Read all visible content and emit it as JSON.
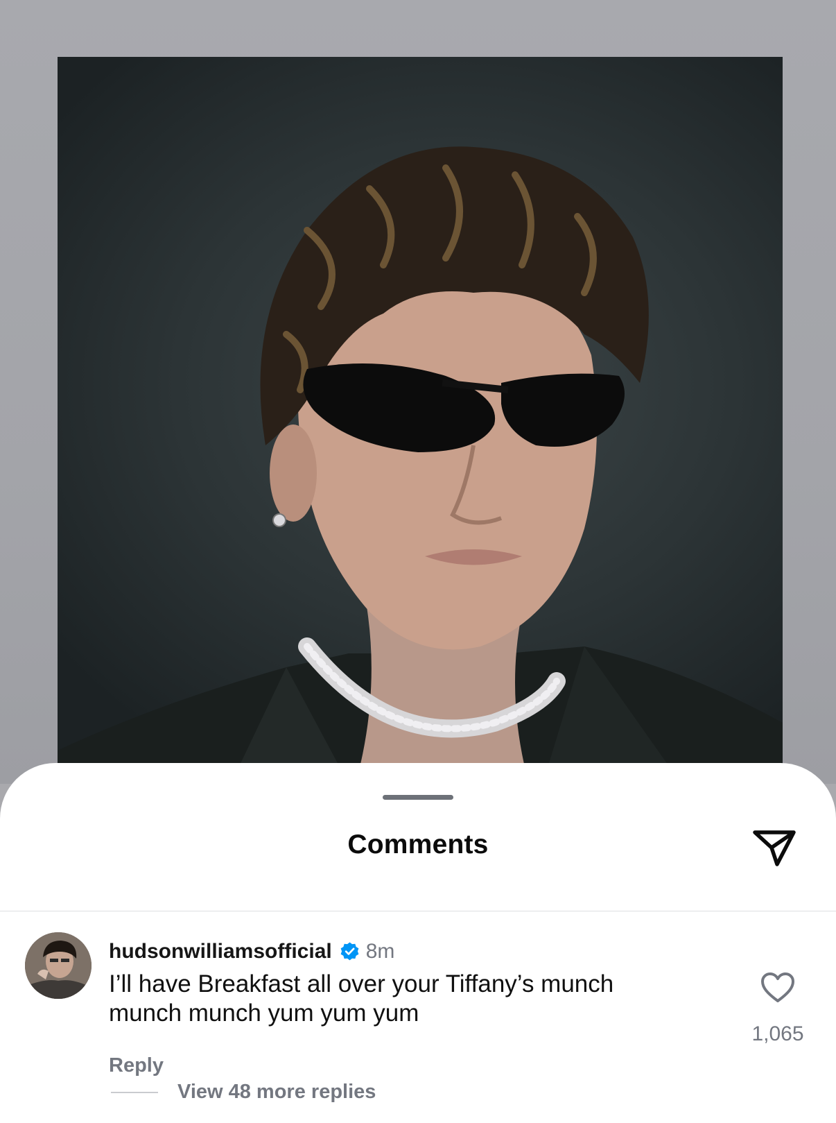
{
  "sheet": {
    "title": "Comments",
    "share_icon": "send-icon"
  },
  "comment": {
    "username": "hudsonwilliamsofficial",
    "verified_icon": "verified-badge-icon",
    "time": "8m",
    "text": "I’ll have Breakfast all over your Tiffany’s munch munch munch yum yum yum",
    "reply_label": "Reply",
    "view_replies_label": "View 48 more replies",
    "like_icon": "heart-icon",
    "like_count": "1,065"
  },
  "colors": {
    "sheet_background": "#ffffff",
    "secondary_text": "#737780",
    "verified_blue": "#0095f6",
    "backdrop": "#a9a9ad"
  }
}
